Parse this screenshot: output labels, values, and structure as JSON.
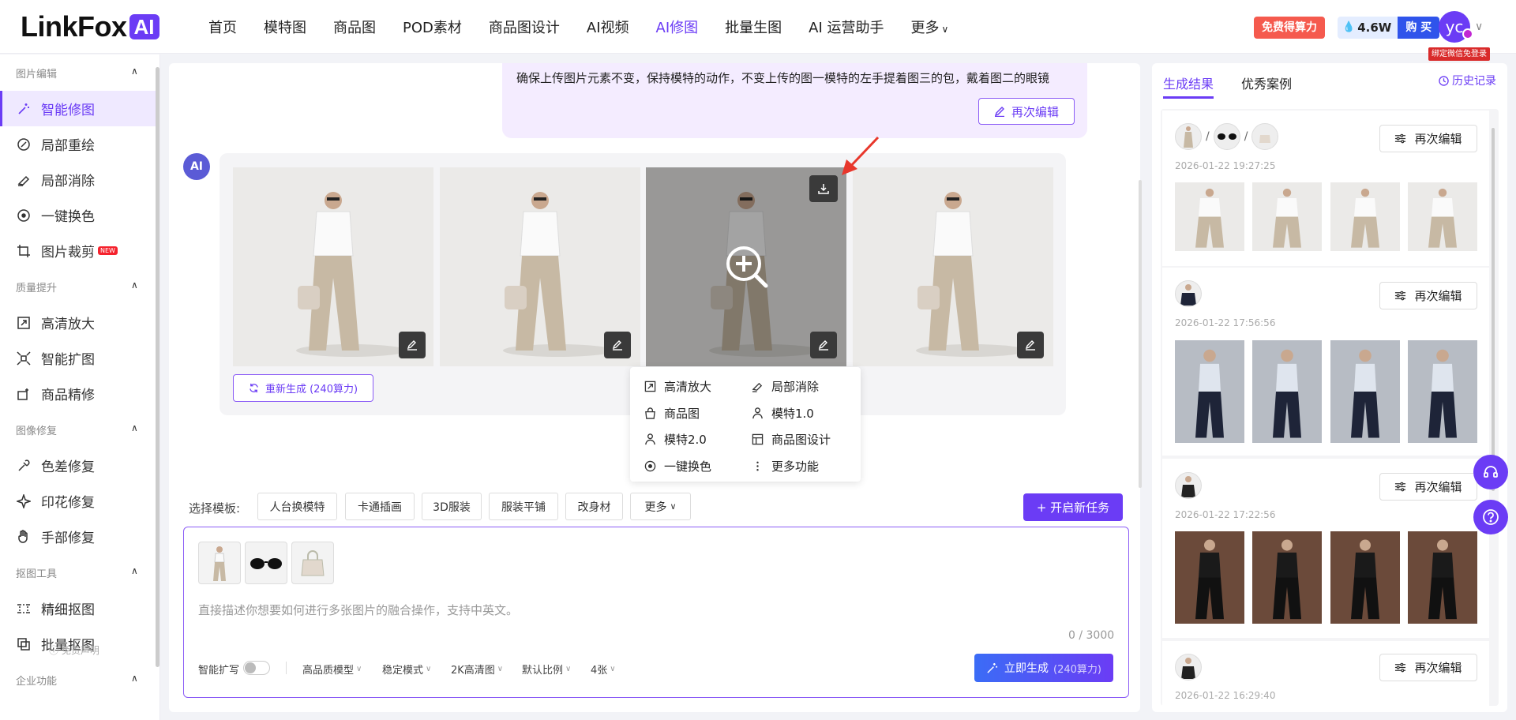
{
  "brand": {
    "logo_text": "LinkFox",
    "logo_ai": "AI"
  },
  "nav": {
    "items": [
      "首页",
      "模特图",
      "商品图",
      "POD素材",
      "商品图设计",
      "AI视频",
      "AI修图",
      "批量生图",
      "AI 运营助手"
    ],
    "more": "更多",
    "active_index": 6
  },
  "header": {
    "free_btn": "免费得算力",
    "credits": "4.6W",
    "buy": "购 买",
    "avatar_initials": "yc",
    "bind_tag": "绑定微信免登录"
  },
  "sidebar": {
    "groups": [
      {
        "title": "图片编辑",
        "items": [
          "智能修图",
          "局部重绘",
          "局部消除",
          "一键换色",
          "图片裁剪"
        ]
      },
      {
        "title": "质量提升",
        "items": [
          "高清放大",
          "智能扩图",
          "商品精修"
        ]
      },
      {
        "title": "图像修复",
        "items": [
          "色差修复",
          "印花修复",
          "手部修复"
        ]
      },
      {
        "title": "抠图工具",
        "items": [
          "精细抠图",
          "批量抠图"
        ]
      },
      {
        "title": "企业功能",
        "items": []
      }
    ],
    "new_tag": "NEW",
    "footer": "免责声明"
  },
  "chat": {
    "user_message": "确保上传图片元素不变，保持模特的动作，不变上传的图一模特的左手提着图三的包，戴着图二的眼镜",
    "reedit": "再次编辑",
    "ai_badge": "AI",
    "regenerate": "重新生成",
    "regenerate_cost": "(240算力)"
  },
  "context_menu": {
    "items": [
      "高清放大",
      "局部消除",
      "商品图",
      "模特1.0",
      "模特2.0",
      "商品图设计",
      "一键换色",
      "更多功能"
    ]
  },
  "templates": {
    "label": "选择模板:",
    "items": [
      "人台换模特",
      "卡通插画",
      "3D服装",
      "服装平铺",
      "改身材"
    ],
    "more": "更多",
    "new_task": "+ 开启新任务"
  },
  "composer": {
    "placeholder": "直接描述你想要如何进行多张图片的融合操作，支持中英文。",
    "char_count": "0 / 3000",
    "smart_expand": "智能扩写",
    "options": [
      "高品质模型",
      "稳定模式",
      "2K高清图",
      "默认比例",
      "4张"
    ],
    "generate": "立即生成",
    "generate_cost": "(240算力)"
  },
  "results": {
    "tabs": [
      "生成结果",
      "优秀案例"
    ],
    "history": "历史记录",
    "reedit": "再次编辑",
    "items": [
      {
        "date": "2026-01-22 19:27:25",
        "theme": "beige"
      },
      {
        "date": "2026-01-22 17:56:56",
        "theme": "coat"
      },
      {
        "date": "2026-01-22 17:22:56",
        "theme": "black"
      },
      {
        "date": "2026-01-22 16:29:40",
        "theme": "black"
      }
    ]
  },
  "colors": {
    "accent": "#6b3cf5",
    "danger": "#f55a4e",
    "blue": "#2f54eb"
  }
}
